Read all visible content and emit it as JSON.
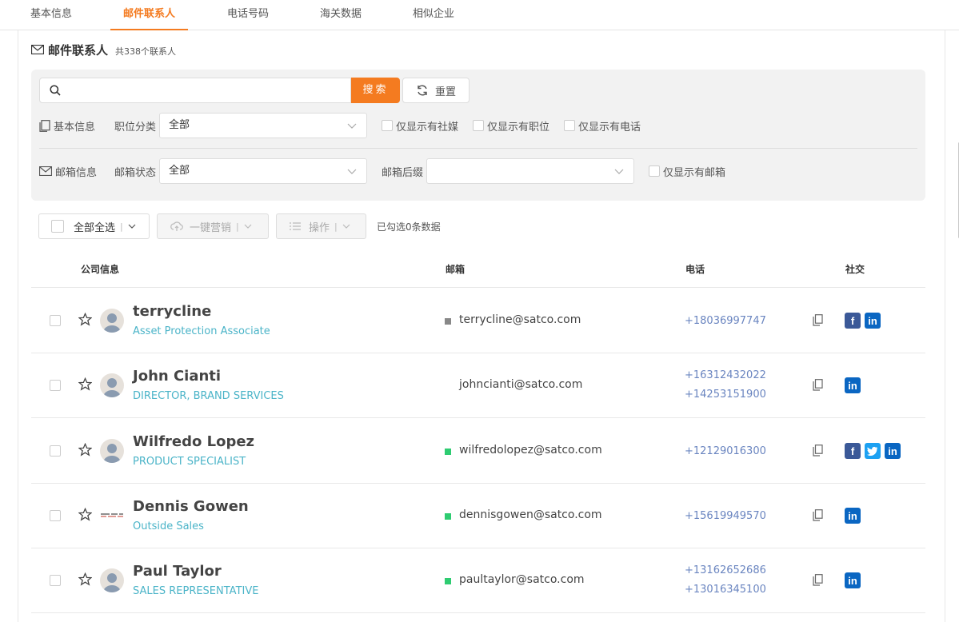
{
  "tabs": [
    "基本信息",
    "邮件联系人",
    "电话号码",
    "海关数据",
    "相似企业"
  ],
  "active_tab": "邮件联系人",
  "section": {
    "title": "邮件联系人",
    "count_text": "共338个联系人"
  },
  "search": {
    "placeholder": "",
    "button": "搜索",
    "reset": "重置"
  },
  "filters": {
    "basic_group": "基本信息",
    "position_label": "职位分类",
    "position_value": "全部",
    "only_social": "仅显示有社媒",
    "only_position": "仅显示有职位",
    "only_phone": "仅显示有电话",
    "email_group": "邮箱信息",
    "email_status_label": "邮箱状态",
    "email_status_value": "全部",
    "email_suffix_label": "邮箱后缀",
    "email_suffix_value": "",
    "only_email": "仅显示有邮箱"
  },
  "toolbar": {
    "select_all": "全部全选",
    "marketing": "一键营销",
    "operations": "操作",
    "selected_text": "已勾选0条数据"
  },
  "columns": {
    "company": "公司信息",
    "email": "邮箱",
    "phone": "电话",
    "social": "社交"
  },
  "colors": {
    "accent": "#f47b20",
    "title": "#4bb4c8",
    "phone": "#6a85c0",
    "verified": "#2ecc71",
    "unknown": "#888888"
  },
  "rows": [
    {
      "name": "terrycline",
      "title": "Asset Protection Associate",
      "email": "terrycline@satco.com",
      "email_status": "unknown",
      "phones": [
        "+18036997747"
      ],
      "social": [
        "facebook",
        "linkedin"
      ]
    },
    {
      "name": "John Cianti",
      "title": "DIRECTOR, BRAND SERVICES",
      "email": "johncianti@satco.com",
      "email_status": "none",
      "phones": [
        "+16312432022",
        "+14253151900"
      ],
      "social": [
        "linkedin"
      ]
    },
    {
      "name": "Wilfredo Lopez",
      "title": "PRODUCT SPECIALIST",
      "email": "wilfredolopez@satco.com",
      "email_status": "verified",
      "phones": [
        "+12129016300"
      ],
      "social": [
        "facebook",
        "twitter",
        "linkedin"
      ]
    },
    {
      "name": "Dennis Gowen",
      "title": "Outside Sales",
      "email": "dennisgowen@satco.com",
      "email_status": "verified",
      "phones": [
        "+15619949570"
      ],
      "social": [
        "linkedin"
      ]
    },
    {
      "name": "Paul Taylor",
      "title": "SALES REPRESENTATIVE",
      "email": "paultaylor@satco.com",
      "email_status": "verified",
      "phones": [
        "+13162652686",
        "+13016345100"
      ],
      "social": [
        "linkedin"
      ]
    }
  ]
}
